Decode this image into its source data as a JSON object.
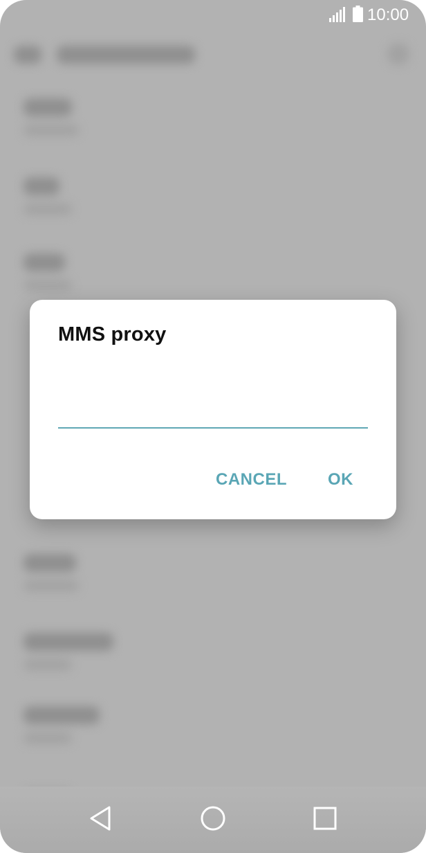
{
  "status_bar": {
    "time": "10:00",
    "icons": [
      "signal-icon",
      "battery-icon"
    ]
  },
  "dialog": {
    "title": "MMS proxy",
    "input_value": "",
    "cancel_label": "CANCEL",
    "ok_label": "OK"
  },
  "nav_bar": {
    "icons": [
      "back-icon",
      "home-icon",
      "recent-apps-icon"
    ]
  },
  "colors": {
    "accent": "#5aa6b5",
    "background": "#b2b2b2",
    "dialog": "#ffffff"
  }
}
